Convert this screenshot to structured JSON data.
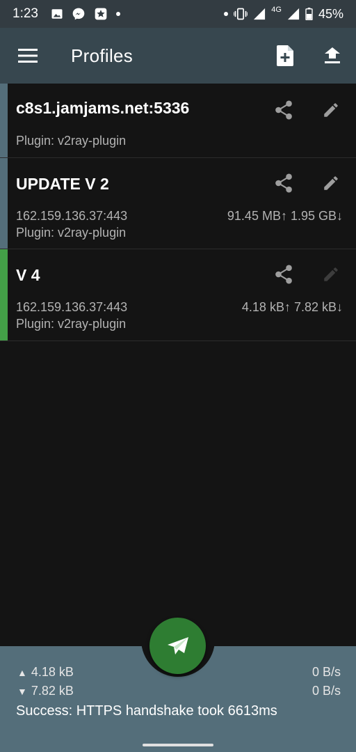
{
  "status_bar": {
    "time": "1:23",
    "network": "4G",
    "battery": "45%"
  },
  "app_bar": {
    "title": "Profiles",
    "icons": [
      "menu-icon",
      "add-file-icon",
      "upload-icon"
    ]
  },
  "profiles": [
    {
      "name": "c8s1.jamjams.net:5336",
      "address": "",
      "plugin": "Plugin: v2ray-plugin",
      "traffic": "",
      "active": false
    },
    {
      "name": "UPDATE V 2",
      "address": "162.159.136.37:443",
      "plugin": "Plugin: v2ray-plugin",
      "traffic": "91.45 MB↑ 1.95 GB↓",
      "active": false
    },
    {
      "name": "V 4",
      "address": "162.159.136.37:443",
      "plugin": "Plugin: v2ray-plugin",
      "traffic": "4.18 kB↑  7.82 kB↓",
      "active": true
    }
  ],
  "colors": {
    "active_bar": "#43a047",
    "inactive_bar": "#546e7a",
    "fab": "#2e7d32",
    "app_bar": "#37474f",
    "bottom_panel": "#546e7a"
  },
  "stats": {
    "tx_total": "4.18 kB",
    "rx_total": "7.82 kB",
    "tx_rate": "0 B/s",
    "rx_rate": "0 B/s",
    "message": "Success: HTTPS handshake took 6613ms"
  }
}
